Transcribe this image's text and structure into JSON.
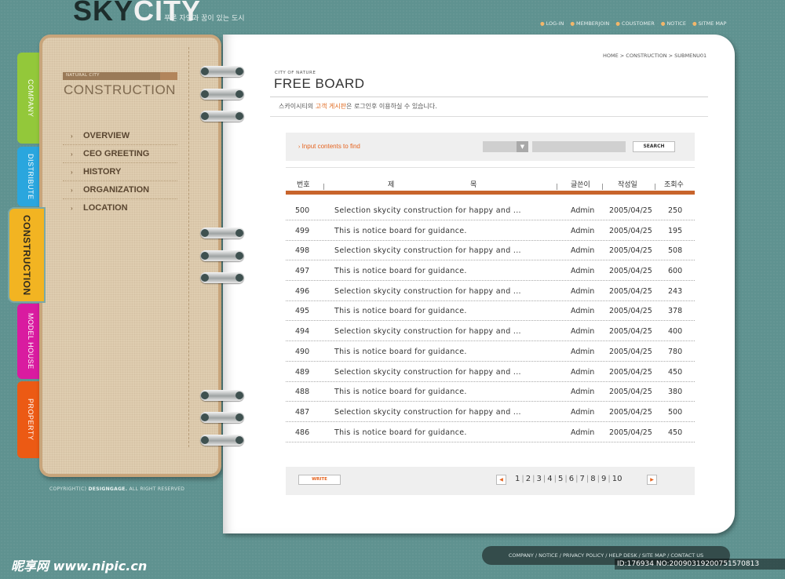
{
  "header": {
    "logo_sky": "SKY",
    "logo_city": "CITY",
    "tagline": "푸른 자연과 꿈이 있는 도시",
    "top_nav": [
      "LOG-IN",
      "MEMBERJOIN",
      "COUSTOMER",
      "NOTICE",
      "SITME MAP"
    ]
  },
  "tabs": [
    "COMPANY",
    "DISTRIBUTE",
    "CONSTRUCTION",
    "MODEL HOUSE",
    "PROPERTY"
  ],
  "sidebar": {
    "small_label": "NATURAL CITY",
    "title": "CONSTRUCTION",
    "items": [
      "OVERVIEW",
      "CEO GREETING",
      "HISTORY",
      "ORGANIZATION",
      "LOCATION"
    ],
    "copyright_prefix": "COPYRIGHT(C)",
    "copyright_brand": "DESIGNGAGE.",
    "copyright_suffix": "ALL RIGHT RESERVED"
  },
  "page": {
    "breadcrumb": "HOME > CONSTRUCTION > SUBMENU01",
    "small_label": "CITY OF NATURE",
    "title": "FREE BOARD",
    "desc_before": "스카이시티의 ",
    "desc_highlight": "고객 게시판",
    "desc_after": "은 로그인후 이용하실 수 있습니다."
  },
  "search": {
    "hint": "Input contents to find",
    "select_arrow": "▼",
    "input_value": "",
    "button": "SEARCH"
  },
  "table": {
    "headers": {
      "num": "번호",
      "subj_a": "제",
      "subj_b": "목",
      "writer": "글쓴이",
      "date": "작성일",
      "views": "조회수"
    },
    "rows": [
      {
        "num": "500",
        "subject": "Selection skycity construction for happy and ...",
        "writer": "Admin",
        "date": "2005/04/25",
        "views": "250"
      },
      {
        "num": "499",
        "subject": "This is notice board for guidance.",
        "writer": "Admin",
        "date": "2005/04/25",
        "views": "195"
      },
      {
        "num": "498",
        "subject": "Selection skycity construction for happy and ...",
        "writer": "Admin",
        "date": "2005/04/25",
        "views": "508"
      },
      {
        "num": "497",
        "subject": "This is notice board for guidance.",
        "writer": "Admin",
        "date": "2005/04/25",
        "views": "600"
      },
      {
        "num": "496",
        "subject": "Selection skycity construction for happy and ...",
        "writer": "Admin",
        "date": "2005/04/25",
        "views": "243"
      },
      {
        "num": "495",
        "subject": "This is notice board for guidance.",
        "writer": "Admin",
        "date": "2005/04/25",
        "views": "378"
      },
      {
        "num": "494",
        "subject": "Selection skycity construction for happy and ...",
        "writer": "Admin",
        "date": "2005/04/25",
        "views": "400"
      },
      {
        "num": "490",
        "subject": "This is notice board for guidance.",
        "writer": "Admin",
        "date": "2005/04/25",
        "views": "780"
      },
      {
        "num": "489",
        "subject": "Selection skycity construction for happy and ...",
        "writer": "Admin",
        "date": "2005/04/25",
        "views": "450"
      },
      {
        "num": "488",
        "subject": "This is notice board for guidance.",
        "writer": "Admin",
        "date": "2005/04/25",
        "views": "380"
      },
      {
        "num": "487",
        "subject": "Selection skycity construction for happy and ...",
        "writer": "Admin",
        "date": "2005/04/25",
        "views": "500"
      },
      {
        "num": "486",
        "subject": "This is notice board for guidance.",
        "writer": "Admin",
        "date": "2005/04/25",
        "views": "450"
      }
    ]
  },
  "pager": {
    "write": "WRITE",
    "prev": "◀",
    "next": "▶",
    "pages": [
      "1",
      "2",
      "3",
      "4",
      "5",
      "6",
      "7",
      "8",
      "9",
      "10"
    ]
  },
  "footer": {
    "links": "COMPANY / NOTICE / PRIVACY POLICY / HELP DESK / SITE MAP / CONTACT US"
  },
  "watermark": {
    "site": "昵享网 www.nipic.cn",
    "id": "ID:176934 NO:20090319200751570813"
  },
  "colors": {
    "accent": "#c8642c",
    "highlight": "#e5631f",
    "background": "#5f9290"
  }
}
